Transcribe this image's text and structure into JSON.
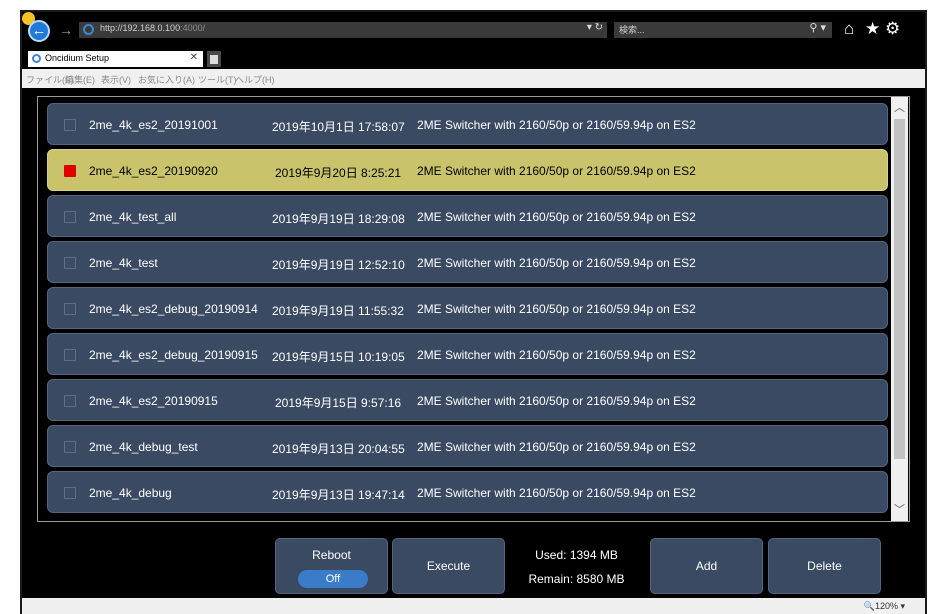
{
  "browser": {
    "url_host": "http://192.168.0.100",
    "url_port": ":4000/",
    "search_placeholder": "検索...",
    "tab_title": "Oncidium Setup",
    "menu": [
      "ファイル(F)",
      "編集(E)",
      "表示(V)",
      "お気に入り(A)",
      "ツール(T)",
      "ヘルプ(H)"
    ],
    "zoom": "🔍120%"
  },
  "rows": [
    {
      "name": "2me_4k_es2_20191001",
      "date": "2019年10月1日 17:58:07",
      "desc": "2ME Switcher with 2160/50p or 2160/59.94p on ES2",
      "selected": false
    },
    {
      "name": "2me_4k_es2_20190920",
      "date": "2019年9月20日 8:25:21",
      "desc": "2ME Switcher with 2160/50p or 2160/59.94p on ES2",
      "selected": true
    },
    {
      "name": "2me_4k_test_all",
      "date": "2019年9月19日 18:29:08",
      "desc": "2ME Switcher with 2160/50p or 2160/59.94p on ES2",
      "selected": false
    },
    {
      "name": "2me_4k_test",
      "date": "2019年9月19日 12:52:10",
      "desc": "2ME Switcher with 2160/50p or 2160/59.94p on ES2",
      "selected": false
    },
    {
      "name": "2me_4k_es2_debug_20190914",
      "date": "2019年9月19日 11:55:32",
      "desc": "2ME Switcher with 2160/50p or 2160/59.94p on ES2",
      "selected": false
    },
    {
      "name": "2me_4k_es2_debug_20190915",
      "date": "2019年9月15日 10:19:05",
      "desc": "2ME Switcher with 2160/50p or 2160/59.94p on ES2",
      "selected": false
    },
    {
      "name": "2me_4k_es2_20190915",
      "date": "2019年9月15日 9:57:16",
      "desc": "2ME Switcher with 2160/50p or 2160/59.94p on ES2",
      "selected": false
    },
    {
      "name": "2me_4k_debug_test",
      "date": "2019年9月13日 20:04:55",
      "desc": "2ME Switcher with 2160/50p or 2160/59.94p on ES2",
      "selected": false
    },
    {
      "name": "2me_4k_debug",
      "date": "2019年9月13日 19:47:14",
      "desc": "2ME Switcher with 2160/50p or 2160/59.94p on ES2",
      "selected": false
    }
  ],
  "controls": {
    "reboot_label": "Reboot",
    "reboot_state": "Off",
    "execute_label": "Execute",
    "used": "Used: 1394 MB",
    "remain": "Remain: 8580 MB",
    "add_label": "Add",
    "delete_label": "Delete"
  },
  "colors": {
    "row_bg": "#3a4a62",
    "selected_row_bg": "#c9c46c",
    "selected_checkbox": "#e00000",
    "toggle_bg": "#3b7cc9"
  }
}
